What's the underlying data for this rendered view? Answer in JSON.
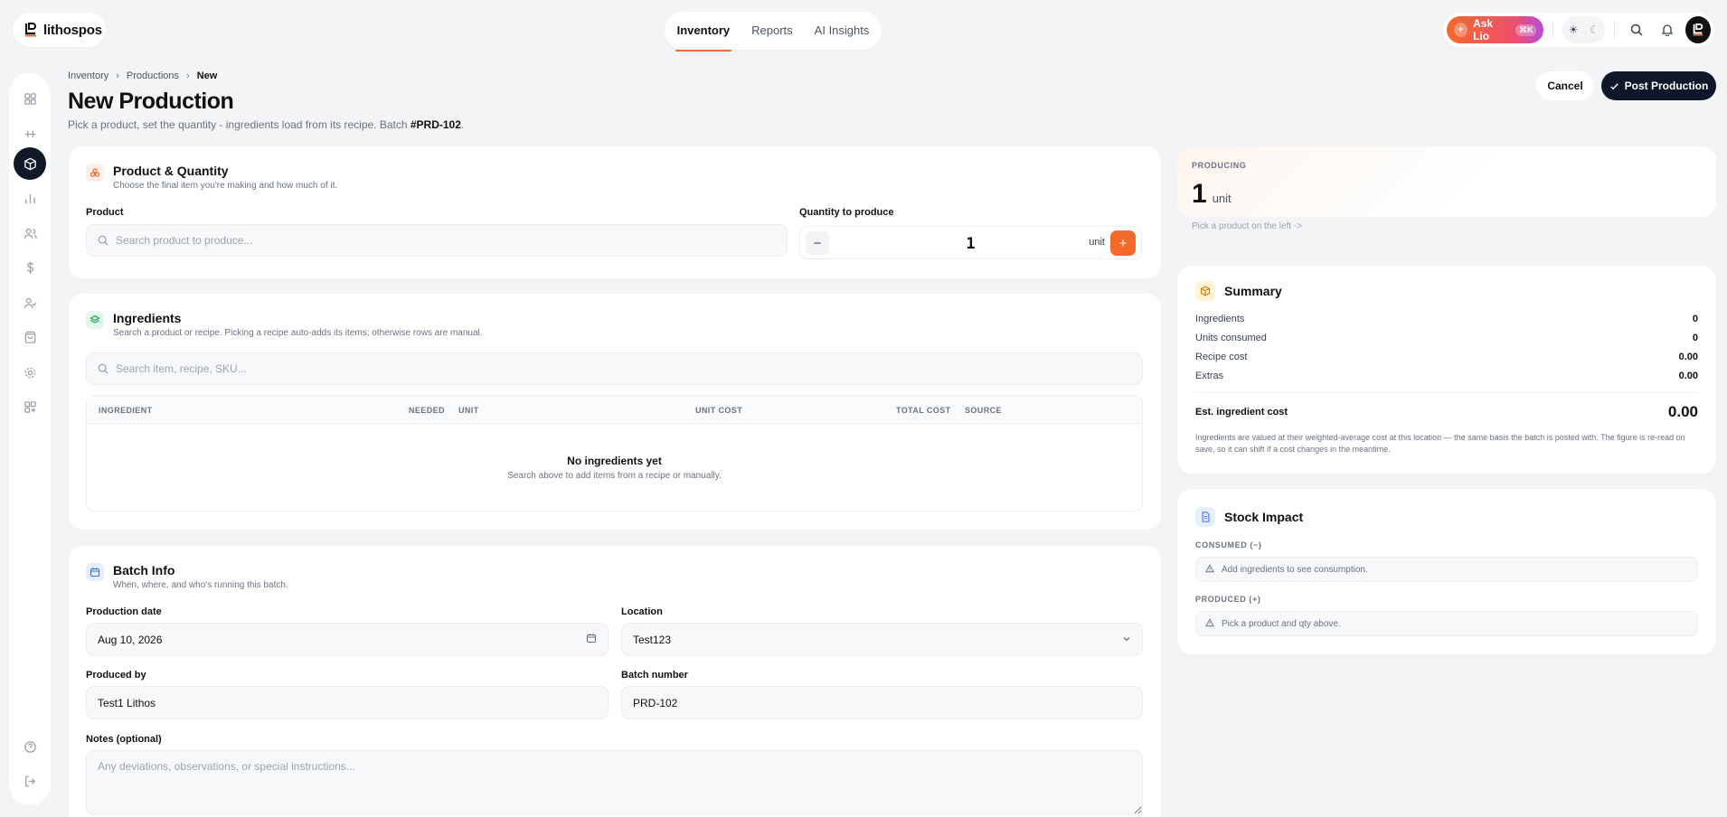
{
  "brand": {
    "name": "lithospos"
  },
  "topnav": {
    "tabs": [
      {
        "label": "Inventory",
        "active": true
      },
      {
        "label": "Reports"
      },
      {
        "label": "AI Insights"
      }
    ]
  },
  "header_actions": {
    "ask_label": "Ask Lio",
    "ask_shortcut": "⌘K"
  },
  "breadcrumb": [
    "Inventory",
    "Productions",
    "New"
  ],
  "page": {
    "title": "New Production",
    "subtitle_text": "Pick a product, set the quantity - ingredients load from its recipe. Batch ",
    "batch_id": "#PRD-102",
    "subtitle_end": ".",
    "cancel_label": "Cancel",
    "post_label": "Post Production"
  },
  "product_card": {
    "title": "Product & Quantity",
    "subtitle": "Choose the final item you're making and how much of it.",
    "product_label": "Product",
    "product_placeholder": "Search product to produce...",
    "quantity_label": "Quantity to produce",
    "quantity_value": "1",
    "quantity_unit": "unit"
  },
  "ingredients_card": {
    "title": "Ingredients",
    "subtitle": "Search a product or recipe. Picking a recipe auto-adds its items; otherwise rows are manual.",
    "search_placeholder": "Search item, recipe, SKU...",
    "columns": [
      "INGREDIENT",
      "NEEDED",
      "UNIT",
      "UNIT COST",
      "TOTAL COST",
      "SOURCE"
    ],
    "empty_title": "No ingredients yet",
    "empty_subtitle": "Search above to add items from a recipe or manually."
  },
  "batch_card": {
    "title": "Batch Info",
    "subtitle": "When, where, and who's running this batch.",
    "date_label": "Production date",
    "date_value": "Aug 10, 2026",
    "location_label": "Location",
    "location_value": "Test123",
    "produced_by_label": "Produced by",
    "produced_by_value": "Test1 Lithos",
    "batch_number_label": "Batch number",
    "batch_number_value": "PRD-102",
    "notes_label": "Notes (optional)",
    "notes_placeholder": "Any deviations, observations, or special instructions..."
  },
  "producing": {
    "overline": "PRODUCING",
    "qty": "1",
    "unit": "unit",
    "hint": "Pick a product on the left ->"
  },
  "summary": {
    "title": "Summary",
    "rows": [
      {
        "label": "Ingredients",
        "value": "0"
      },
      {
        "label": "Units consumed",
        "value": "0"
      },
      {
        "label": "Recipe cost",
        "value": "0.00"
      },
      {
        "label": "Extras",
        "value": "0.00"
      }
    ],
    "total_label": "Est. ingredient cost",
    "total_value": "0.00",
    "note": "Ingredients are valued at their weighted-average cost at this location — the same basis the batch is posted with. The figure is re-read on save, so it can shift if a cost changes in the meantime."
  },
  "stock_impact": {
    "title": "Stock Impact",
    "consumed_label": "CONSUMED (−)",
    "consumed_note": "Add ingredients to see consumption.",
    "produced_label": "PRODUCED (+)",
    "produced_note": "Pick a product and qty above."
  },
  "colors": {
    "accent": "#f26b2a",
    "dark": "#0f172a",
    "background": "#f3f4f6"
  }
}
